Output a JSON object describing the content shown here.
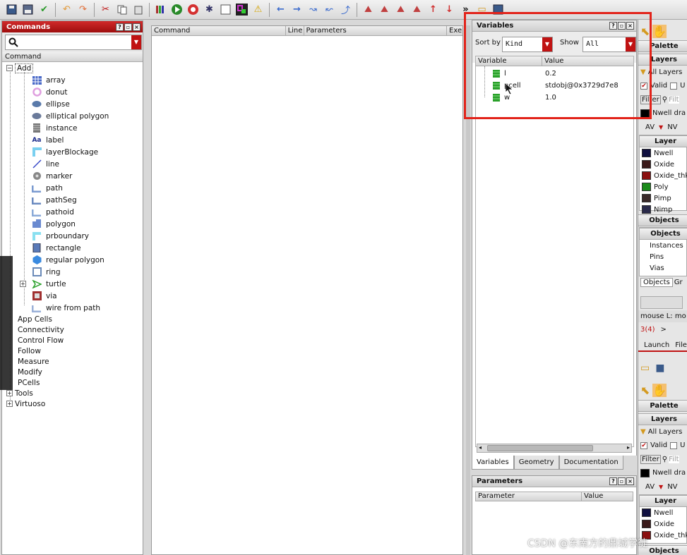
{
  "toolbar": {
    "icons": [
      "save-icon",
      "save-as-icon",
      "check-icon",
      "undo-icon",
      "redo-icon",
      "cut-icon",
      "copy-icon",
      "paste-icon",
      "library-icon",
      "run-icon",
      "stop-icon",
      "step-icon",
      "blank-icon",
      "layout-icon",
      "warning-icon",
      "back-icon",
      "forward-icon",
      "undo-arc-icon",
      "redo-arc-icon",
      "up-icon",
      "zoom-a-icon",
      "zoom-b-icon",
      "zoom-c-icon",
      "zoom-d-icon",
      "up-red-icon",
      "down-red-icon"
    ],
    "overflow": "»"
  },
  "commands": {
    "title": "Commands",
    "column_header": "Command",
    "add_label": "Add",
    "add_items": [
      {
        "label": "array",
        "icon": "array-icon"
      },
      {
        "label": "donut",
        "icon": "donut-icon"
      },
      {
        "label": "ellipse",
        "icon": "ellipse-icon"
      },
      {
        "label": "elliptical polygon",
        "icon": "elliptical-polygon-icon"
      },
      {
        "label": "instance",
        "icon": "instance-icon"
      },
      {
        "label": "label",
        "icon": "label-icon"
      },
      {
        "label": "layerBlockage",
        "icon": "layer-blockage-icon"
      },
      {
        "label": "line",
        "icon": "line-icon"
      },
      {
        "label": "marker",
        "icon": "marker-icon"
      },
      {
        "label": "path",
        "icon": "path-icon"
      },
      {
        "label": "pathSeg",
        "icon": "path-seg-icon"
      },
      {
        "label": "pathoid",
        "icon": "pathoid-icon"
      },
      {
        "label": "polygon",
        "icon": "polygon-icon"
      },
      {
        "label": "prboundary",
        "icon": "prboundary-icon"
      },
      {
        "label": "rectangle",
        "icon": "rectangle-icon"
      },
      {
        "label": "regular polygon",
        "icon": "regular-polygon-icon"
      },
      {
        "label": "ring",
        "icon": "ring-icon"
      },
      {
        "label": "turtle",
        "icon": "turtle-icon"
      },
      {
        "label": "via",
        "icon": "via-icon"
      },
      {
        "label": "wire from path",
        "icon": "wire-from-path-icon"
      }
    ],
    "categories": [
      "App Cells",
      "Connectivity",
      "Control Flow",
      "Follow",
      "Measure",
      "Modify",
      "PCells",
      "Tools",
      "Virtuoso"
    ],
    "label_icon_text": "Aa"
  },
  "history": {
    "col_command": "Command",
    "col_line": "Line",
    "col_parameters": "Parameters",
    "col_exec": "Exe"
  },
  "variables": {
    "title": "Variables",
    "sort_by_label": "Sort by",
    "sort_by_value": "Kind",
    "show_label": "Show",
    "show_value": "All",
    "col_variable": "Variable",
    "col_value": "Value",
    "rows": [
      {
        "name": "l",
        "value": "0.2"
      },
      {
        "name": "pcell",
        "value": "stdobj@0x3729d7e8"
      },
      {
        "name": "w",
        "value": "1.0"
      }
    ],
    "tabs": [
      "Variables",
      "Geometry",
      "Documentation"
    ]
  },
  "parameters": {
    "title": "Parameters",
    "col_parameter": "Parameter",
    "col_value": "Value"
  },
  "palette": {
    "palette_label": "Palette",
    "layers_label": "Layers",
    "all_layers": "All Layers",
    "valid_label": "Valid",
    "u_label": "U",
    "filter_label": "Filter",
    "filter_placeholder": "Filt",
    "nwell_drawing": "Nwell dra",
    "av_label": "AV",
    "nv_label": "NV",
    "layer_header": "Layer",
    "layers": [
      {
        "name": "Nwell",
        "color": "#101040"
      },
      {
        "name": "Oxide",
        "color": "#3a1a1a"
      },
      {
        "name": "Oxide_thk",
        "color": "#8a1010"
      },
      {
        "name": "Poly",
        "color": "#1a8a1a"
      },
      {
        "name": "Pimp",
        "color": "#3a2a2a"
      },
      {
        "name": "Nimp",
        "color": "#2a2a4a"
      }
    ],
    "objects_label": "Objects",
    "objects_header": "Objects",
    "object_items": [
      "Instances",
      "Pins",
      "Vias"
    ],
    "objects_tab": "Objects",
    "gr_tab": "Gr",
    "mouse_label": "mouse L: mo",
    "count_label": "3(4)",
    "prompt": ">",
    "launch_label": "Launch",
    "file_label": "File"
  },
  "watermark": "CSDN @东南方的鼎城学徒"
}
